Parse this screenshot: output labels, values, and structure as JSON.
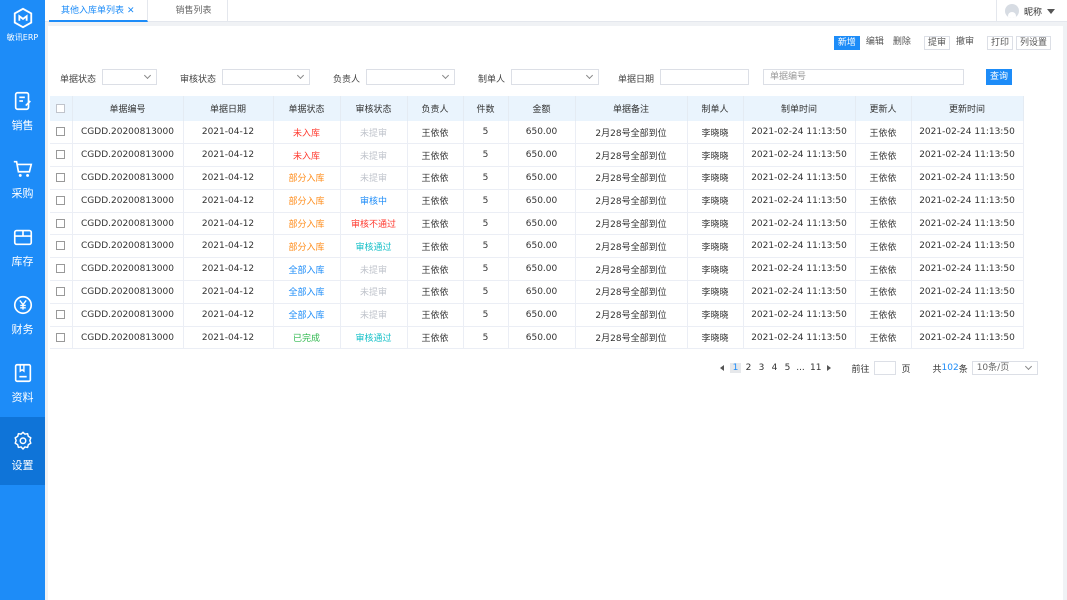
{
  "app": {
    "name": "敏讯ERP"
  },
  "sidebar": {
    "items": [
      {
        "label": "销售",
        "icon": "sales-document-icon"
      },
      {
        "label": "采购",
        "icon": "shopping-cart-icon"
      },
      {
        "label": "库存",
        "icon": "inventory-box-icon"
      },
      {
        "label": "财务",
        "icon": "yuan-coin-icon"
      },
      {
        "label": "资料",
        "icon": "document-folder-icon"
      },
      {
        "label": "设置",
        "icon": "gear-icon"
      }
    ],
    "active": "设置"
  },
  "tabs": [
    {
      "label": "其他入库单列表",
      "closable": true,
      "active": true
    },
    {
      "label": "销售列表",
      "closable": false,
      "active": false
    }
  ],
  "user": {
    "name": "昵称"
  },
  "toolbar": {
    "buttons": [
      "新增",
      "编辑",
      "删除",
      "提审",
      "撤审",
      "打印",
      "列设置"
    ]
  },
  "filters": {
    "doc_status_label": "单据状态",
    "audit_status_label": "审核状态",
    "owner_label": "负责人",
    "creator_label": "制单人",
    "doc_date_label": "单据日期",
    "doc_no_placeholder": "单据编号",
    "search_button": "查询"
  },
  "table": {
    "columns": [
      "单据编号",
      "单据日期",
      "单据状态",
      "审核状态",
      "负责人",
      "件数",
      "金额",
      "单据备注",
      "制单人",
      "制单时间",
      "更新人",
      "更新时间"
    ],
    "rows": [
      {
        "no": "CGDD.20200813000",
        "date": "2021-04-12",
        "status": "未入库",
        "audit": "未提审",
        "owner": "王依依",
        "qty": "5",
        "amount": "650.00",
        "remark": "2月28号全部到位",
        "creator": "李晓晓",
        "created": "2021-02-24  11:13:50",
        "updater": "王依依",
        "updated": "2021-02-24  11:13:50"
      },
      {
        "no": "CGDD.20200813000",
        "date": "2021-04-12",
        "status": "未入库",
        "audit": "未提审",
        "owner": "王依依",
        "qty": "5",
        "amount": "650.00",
        "remark": "2月28号全部到位",
        "creator": "李晓晓",
        "created": "2021-02-24  11:13:50",
        "updater": "王依依",
        "updated": "2021-02-24  11:13:50"
      },
      {
        "no": "CGDD.20200813000",
        "date": "2021-04-12",
        "status": "部分入库",
        "audit": "未提审",
        "owner": "王依依",
        "qty": "5",
        "amount": "650.00",
        "remark": "2月28号全部到位",
        "creator": "李晓晓",
        "created": "2021-02-24  11:13:50",
        "updater": "王依依",
        "updated": "2021-02-24  11:13:50"
      },
      {
        "no": "CGDD.20200813000",
        "date": "2021-04-12",
        "status": "部分入库",
        "audit": "审核中",
        "owner": "王依依",
        "qty": "5",
        "amount": "650.00",
        "remark": "2月28号全部到位",
        "creator": "李晓晓",
        "created": "2021-02-24  11:13:50",
        "updater": "王依依",
        "updated": "2021-02-24  11:13:50"
      },
      {
        "no": "CGDD.20200813000",
        "date": "2021-04-12",
        "status": "部分入库",
        "audit": "审核不通过",
        "owner": "王依依",
        "qty": "5",
        "amount": "650.00",
        "remark": "2月28号全部到位",
        "creator": "李晓晓",
        "created": "2021-02-24  11:13:50",
        "updater": "王依依",
        "updated": "2021-02-24  11:13:50"
      },
      {
        "no": "CGDD.20200813000",
        "date": "2021-04-12",
        "status": "部分入库",
        "audit": "审核通过",
        "owner": "王依依",
        "qty": "5",
        "amount": "650.00",
        "remark": "2月28号全部到位",
        "creator": "李晓晓",
        "created": "2021-02-24  11:13:50",
        "updater": "王依依",
        "updated": "2021-02-24  11:13:50"
      },
      {
        "no": "CGDD.20200813000",
        "date": "2021-04-12",
        "status": "全部入库",
        "audit": "未提审",
        "owner": "王依依",
        "qty": "5",
        "amount": "650.00",
        "remark": "2月28号全部到位",
        "creator": "李晓晓",
        "created": "2021-02-24  11:13:50",
        "updater": "王依依",
        "updated": "2021-02-24  11:13:50"
      },
      {
        "no": "CGDD.20200813000",
        "date": "2021-04-12",
        "status": "全部入库",
        "audit": "未提审",
        "owner": "王依依",
        "qty": "5",
        "amount": "650.00",
        "remark": "2月28号全部到位",
        "creator": "李晓晓",
        "created": "2021-02-24  11:13:50",
        "updater": "王依依",
        "updated": "2021-02-24  11:13:50"
      },
      {
        "no": "CGDD.20200813000",
        "date": "2021-04-12",
        "status": "全部入库",
        "audit": "未提审",
        "owner": "王依依",
        "qty": "5",
        "amount": "650.00",
        "remark": "2月28号全部到位",
        "creator": "李晓晓",
        "created": "2021-02-24  11:13:50",
        "updater": "王依依",
        "updated": "2021-02-24  11:13:50"
      },
      {
        "no": "CGDD.20200813000",
        "date": "2021-04-12",
        "status": "已完成",
        "audit": "审核通过",
        "owner": "王依依",
        "qty": "5",
        "amount": "650.00",
        "remark": "2月28号全部到位",
        "creator": "李晓晓",
        "created": "2021-02-24  11:13:50",
        "updater": "王依依",
        "updated": "2021-02-24  11:13:50"
      }
    ],
    "status_colors": {
      "未入库": "#ff3b30",
      "部分入库": "#ff8c1a",
      "全部入库": "#1d8cf8",
      "已完成": "#2db84d"
    },
    "audit_colors": {
      "未提审": "#c0c4cc",
      "审核中": "#1d8cf8",
      "审核不通过": "#ff3b30",
      "审核通过": "#17c0c8"
    }
  },
  "pagination": {
    "pages": [
      "1",
      "2",
      "3",
      "4",
      "5",
      "...",
      "11"
    ],
    "current": "1",
    "goto_label": "前往",
    "page_unit": "页",
    "total_prefix": "共",
    "total": "102",
    "total_suffix": "条",
    "page_size": "10条/页"
  },
  "colors": {
    "primary": "#1d8cf8"
  }
}
